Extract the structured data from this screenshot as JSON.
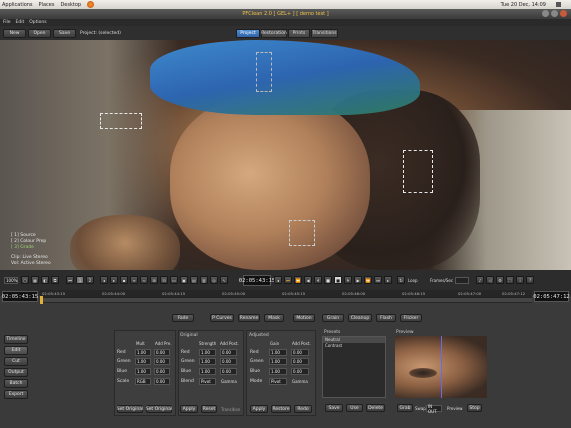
{
  "system_bar": {
    "menus": [
      "Applications",
      "Places",
      "Desktop"
    ],
    "clock": "Tue 20 Dec, 14:09"
  },
  "window": {
    "title": "PFClean 2.0 [ GEL+ ] [ demo test ]"
  },
  "menubar": [
    "File",
    "Edit",
    "Options"
  ],
  "toolbar": {
    "new_label": "New",
    "open_label": "Open",
    "save_label": "Save",
    "project_label": "Project: (selected)",
    "tabs": [
      "Project",
      "Restoration",
      "Prints",
      "Transitions"
    ],
    "active_tab": "Project"
  },
  "overlay": {
    "lines": [
      "[ 1] Source",
      "[ 2] Colour Prep",
      "[ 3] Grade"
    ],
    "info1": "Clip: Live Stereo",
    "info2": "Vol: Active Stereo"
  },
  "transport": {
    "zoom": "100%",
    "current_tc": "02:05:43:15",
    "end_tc": "02:05:47:12",
    "start_tc": "02:05:43:15",
    "frames_label": "Frames/Sec",
    "loop_label": "Loop",
    "ruler_ticks": [
      "02:05:43:15",
      "02:05:44:00",
      "02:05:44:15",
      "02:05:45:00",
      "02:05:45:15",
      "02:05:46:00",
      "02:05:46:15",
      "02:05:47:00",
      "02:05:47:12"
    ]
  },
  "side_buttons": [
    "Timeline",
    "Edit",
    "Cut",
    "Output",
    "Batch",
    "Export"
  ],
  "mode_buttons": [
    "Fade",
    "P Curves",
    "Rename",
    "Mask",
    "Motion",
    "Grain",
    "Cleanup",
    "Flash",
    "Flicker"
  ],
  "grade": {
    "group1": {
      "cols": [
        "Mult",
        "Add Pre."
      ],
      "rows": [
        {
          "label": "Red",
          "a": "1.00",
          "b": "0.00"
        },
        {
          "label": "Green",
          "a": "1.00",
          "b": "0.00"
        },
        {
          "label": "Blue",
          "a": "1.00",
          "b": "0.00"
        },
        {
          "label": "Scale",
          "a": "RGB",
          "b": "0.00"
        }
      ],
      "buttons": [
        "Set Original",
        "Set Original"
      ]
    },
    "group2": {
      "title": "Original",
      "cols": [
        "Strength",
        "Add Post."
      ],
      "rows": [
        {
          "label": "Red",
          "a": "1.00",
          "b": "0.00"
        },
        {
          "label": "Green",
          "a": "1.00",
          "b": "0.00"
        },
        {
          "label": "Blue",
          "a": "1.00",
          "b": "0.00"
        },
        {
          "label": "Blend",
          "a": "Pivot",
          "b": "Gamma"
        }
      ],
      "buttons": [
        "Apply",
        "Reset",
        "Transition"
      ]
    },
    "group3": {
      "title": "Adjusted",
      "cols": [
        "Gain",
        "Add Post."
      ],
      "rows": [
        {
          "label": "Red",
          "a": "1.00",
          "b": "0.00"
        },
        {
          "label": "Green",
          "a": "1.00",
          "b": "0.00"
        },
        {
          "label": "Blue",
          "a": "1.00",
          "b": "0.00"
        },
        {
          "label": "Mode",
          "a": "Pivot",
          "b": "Gamma"
        }
      ],
      "buttons": [
        "Apply",
        "Restore",
        "Redo"
      ]
    },
    "presets": {
      "title": "Presets",
      "items": [
        "Neutral",
        "Contrast"
      ],
      "buttons": [
        "Save",
        "Use",
        "Delete"
      ]
    },
    "preview": {
      "title": "Preview",
      "buttons": [
        "Grab",
        "Swap",
        "Preview",
        "Stop"
      ],
      "select_value": "IN OUT"
    }
  }
}
